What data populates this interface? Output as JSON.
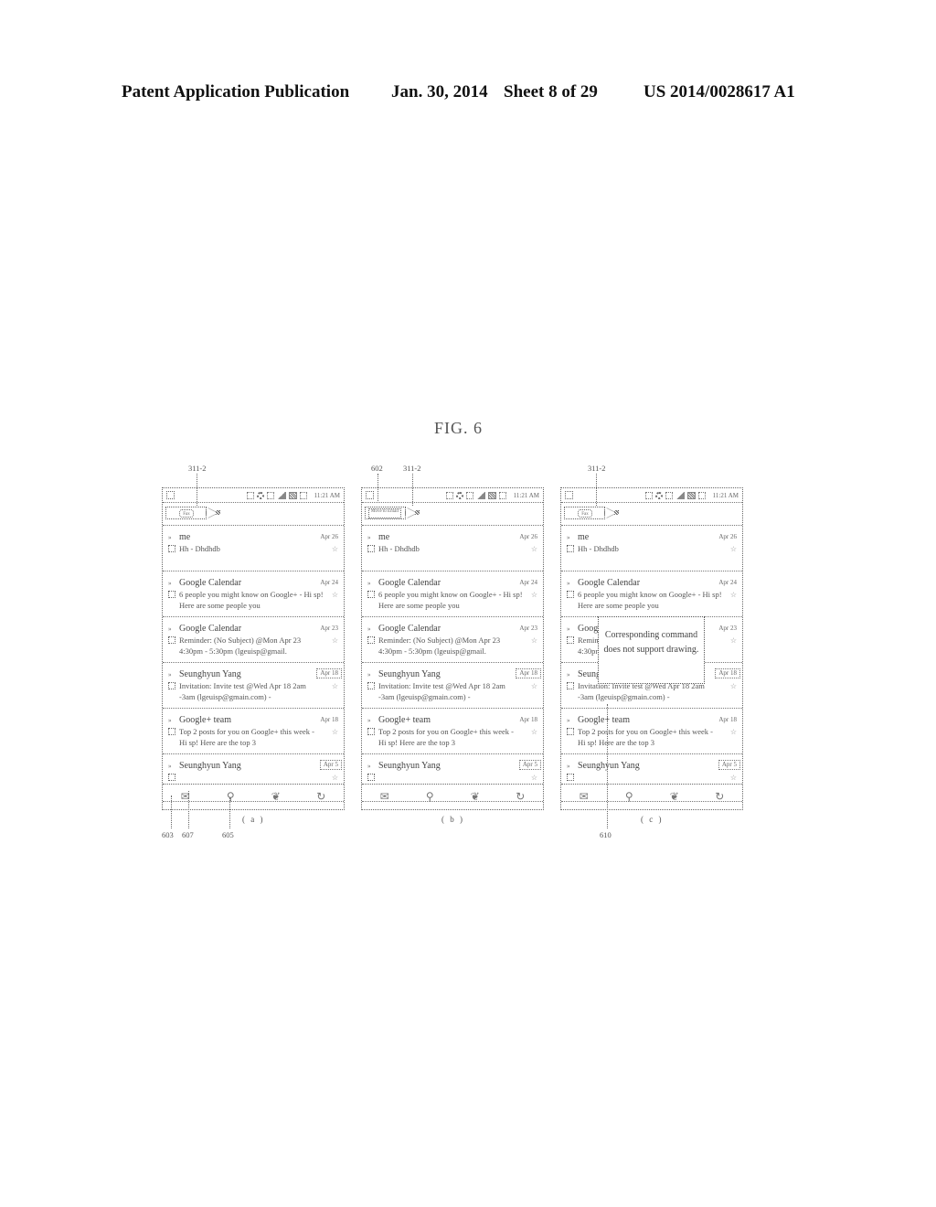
{
  "header": {
    "publication": "Patent Application Publication",
    "date": "Jan. 30, 2014",
    "sheet": "Sheet 8 of 29",
    "number": "US 2014/0028617 A1"
  },
  "figure_title": "FIG. 6",
  "status_bar": {
    "time": "11:21 AM"
  },
  "panels": [
    {
      "caption": "( a )",
      "pen_label": "Fax",
      "refs": [
        "311-2",
        "603",
        "607",
        "605"
      ]
    },
    {
      "caption": "( b )",
      "pen_label": "Move to Email",
      "refs": [
        "602",
        "311-2"
      ]
    },
    {
      "caption": "( c )",
      "pen_label": "Fax",
      "refs": [
        "311-2",
        "610"
      ],
      "popup": "Corresponding command does not support drawing."
    }
  ],
  "emails": [
    {
      "sender": "me",
      "date": "Apr 26",
      "snippet": "Hh - Dhdhdb",
      "date_boxed": false
    },
    {
      "sender": "Google Calendar",
      "date": "Apr 24",
      "snippet": "6 people you might know on Google+ - Hi sp! Here are some people you",
      "date_boxed": false
    },
    {
      "sender": "Google Calendar",
      "date": "Apr 23",
      "snippet": "Reminder: (No Subject) @Mon Apr 23 4:30pm - 5:30pm (lgeuisp@gmail.",
      "date_boxed": false
    },
    {
      "sender": "Seunghyun Yang",
      "date": "Apr 18",
      "snippet": "Invitation: Invite test @Wed Apr 18 2am -3am (lgeuisp@gmain.com) -",
      "date_boxed": true
    },
    {
      "sender": "Google+ team",
      "date": "Apr 18",
      "snippet": "Top 2 posts for you on Google+ this week - Hi sp! Here are the top 3",
      "date_boxed": false
    },
    {
      "sender": "Seunghyun Yang",
      "date": "Apr 5",
      "snippet": "",
      "date_boxed": true
    }
  ],
  "bottom_bar_icons": [
    "compose-mail-icon",
    "search-icon",
    "label-tag-icon",
    "refresh-icon"
  ]
}
